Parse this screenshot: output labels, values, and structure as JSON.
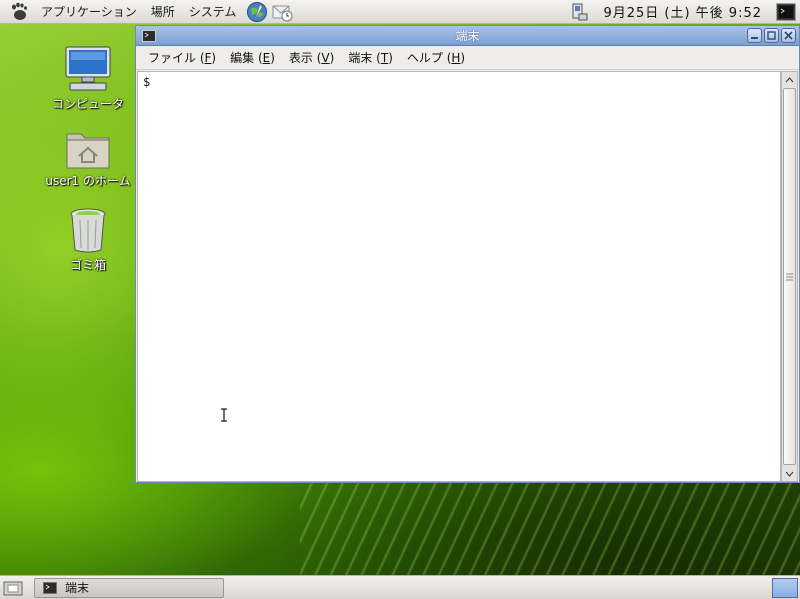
{
  "top_panel": {
    "menus": [
      "アプリケーション",
      "場所",
      "システム"
    ],
    "clock": "9月25日 (土) 午後 9:52"
  },
  "desktop": {
    "icons": [
      {
        "label": "コンピュータ",
        "icon": "computer-icon"
      },
      {
        "label": "user1 のホーム",
        "icon": "home-folder-icon"
      },
      {
        "label": "ゴミ箱",
        "icon": "trash-icon"
      }
    ]
  },
  "window": {
    "title": "端末",
    "menus": [
      {
        "label": "ファイル",
        "mnemonic": "F"
      },
      {
        "label": "編集",
        "mnemonic": "E"
      },
      {
        "label": "表示",
        "mnemonic": "V"
      },
      {
        "label": "端末",
        "mnemonic": "T"
      },
      {
        "label": "ヘルプ",
        "mnemonic": "H"
      }
    ],
    "prompt": "$"
  },
  "bottom_panel": {
    "tasks": [
      {
        "label": "端末"
      }
    ]
  },
  "colors": {
    "titlebar": "#7c9fd2",
    "desktop_green": "#4e9b08"
  }
}
